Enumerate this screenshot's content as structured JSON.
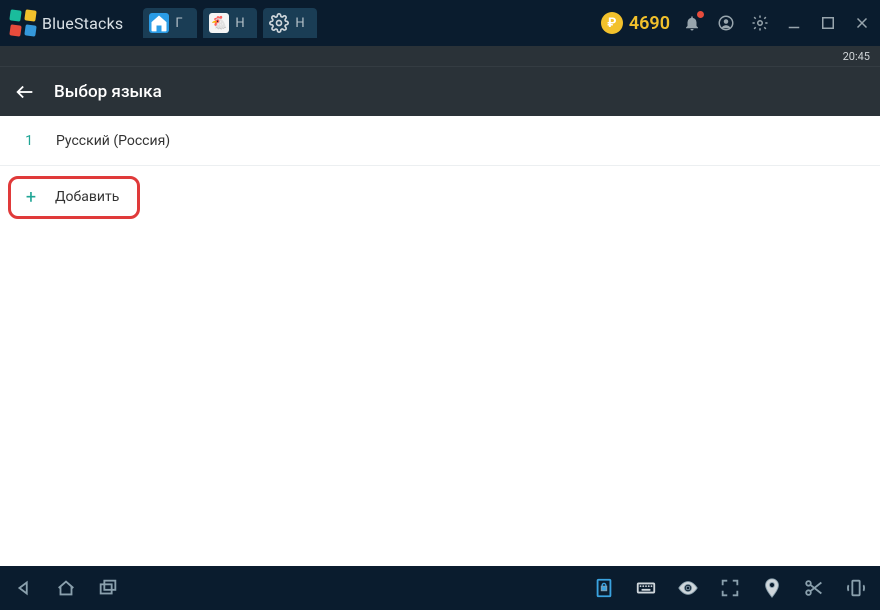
{
  "titlebar": {
    "brand": "BlueStacks",
    "tabs": [
      {
        "label": "Г"
      },
      {
        "label": "Н"
      },
      {
        "label": "Н"
      }
    ],
    "coins": "4690"
  },
  "clock": {
    "time": "20:45"
  },
  "appbar": {
    "title": "Выбор языка"
  },
  "list": {
    "items": [
      {
        "index": "1",
        "label": "Русский (Россия)"
      }
    ],
    "add_label": "Добавить"
  }
}
